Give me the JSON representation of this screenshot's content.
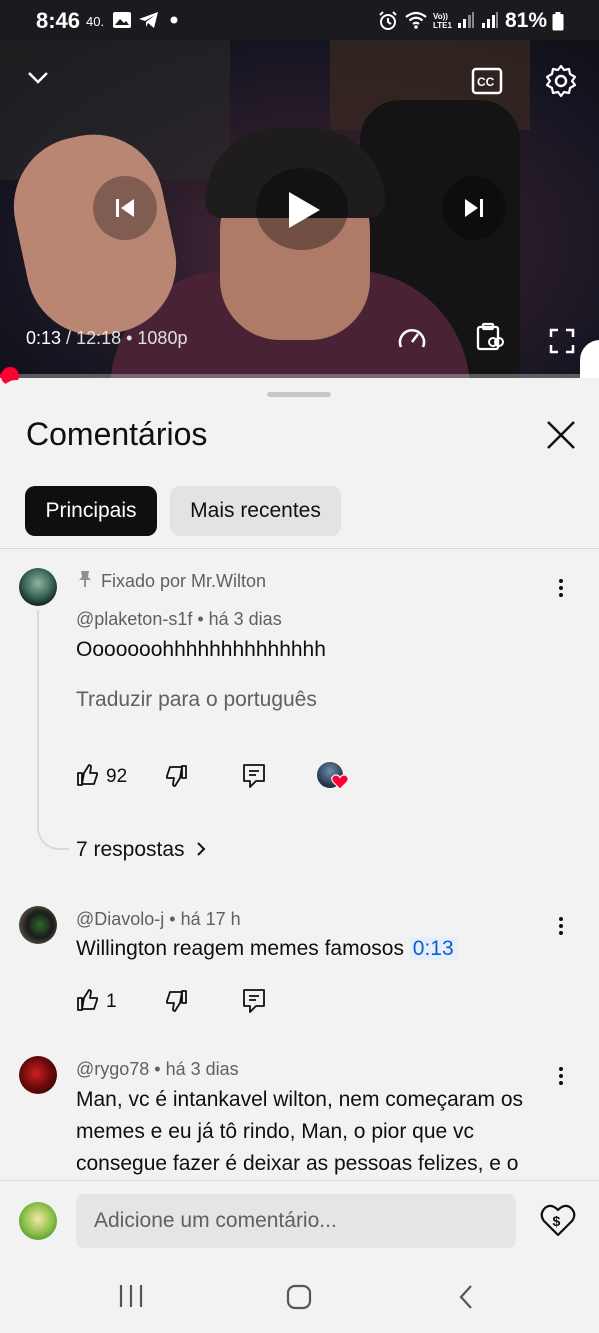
{
  "status_bar": {
    "time": "8:46",
    "small_label": "40.",
    "battery": "81%",
    "icons": [
      "image-icon",
      "telegram-icon",
      "dot-icon",
      "alarm-icon",
      "wifi-icon",
      "volte-icon",
      "signal-icon",
      "signal-icon",
      "battery-icon"
    ]
  },
  "video": {
    "current_time": "0:13",
    "separator": " / ",
    "duration": "12:18 • 1080p",
    "progress_fraction": 0.018,
    "icons": [
      "chevron-down-icon",
      "captions-icon",
      "settings-icon",
      "previous-icon",
      "play-icon",
      "next-icon",
      "speed-icon",
      "clip-icon",
      "fullscreen-icon"
    ]
  },
  "sheet": {
    "title": "Comentários",
    "chips": [
      "Principais",
      "Mais recentes"
    ]
  },
  "comments": [
    {
      "pinned_label": "Fixado por Mr.Wilton",
      "meta": "@plaketon-s1f • há 3 dias",
      "text": "Ooooooohhhhhhhhhhhhhh",
      "translate": "Traduzir para o português",
      "likes": "92",
      "replies": "7 respostas"
    },
    {
      "meta": "@Diavolo-j • há 17 h",
      "text": "Willington reagem memes famosos",
      "timestamp": "0:13",
      "likes": "1"
    },
    {
      "meta": "@rygo78 • há 3 dias",
      "text": "Man, vc é intankavel wilton, nem começaram os memes e eu já tô rindo, Man, o pior que vc consegue fazer é deixar as pessoas felizes, e o"
    }
  ],
  "input": {
    "placeholder": "Adicione um comentário..."
  },
  "colors": {
    "accent": "#ff0033",
    "link": "#065fd4",
    "background": "#f2f2f2"
  }
}
